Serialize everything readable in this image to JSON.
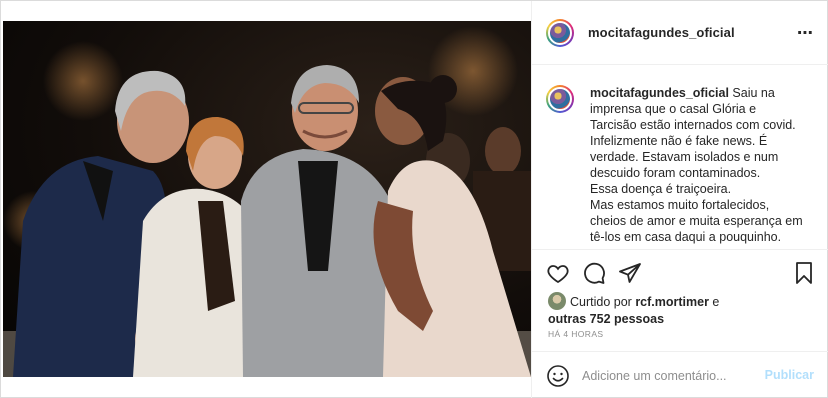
{
  "post": {
    "username": "mocitafagundes_oficial",
    "more_icon": "⋯",
    "caption": {
      "username": "mocitafagundes_oficial",
      "text": " Saiu na imprensa que o casal Glória e Tarcisão estão internados com covid.\nInfelizmente não é fake news. É verdade. Estavam isolados e num descuido foram contaminados.\nEssa doença é traiçoeira.\nMas estamos muito fortalecidos, cheios de amor e muita esperança em tê-los em casa daqui a pouquinho."
    },
    "actions": {
      "icons": [
        "heart-icon",
        "comment-icon",
        "share-icon",
        "bookmark-icon"
      ]
    },
    "likes": {
      "prefix": "Curtido por ",
      "user": "rcf.mortimer",
      "middle": " e",
      "others": "outras 752 pessoas"
    },
    "timestamp": "HÁ 4 HORAS",
    "comment": {
      "placeholder": "Adicione um comentário...",
      "publish_label": "Publicar"
    }
  },
  "colors": {
    "publish_disabled": "#b2dffc",
    "muted_text": "#8e8e8e",
    "border": "#dbdbdb"
  }
}
